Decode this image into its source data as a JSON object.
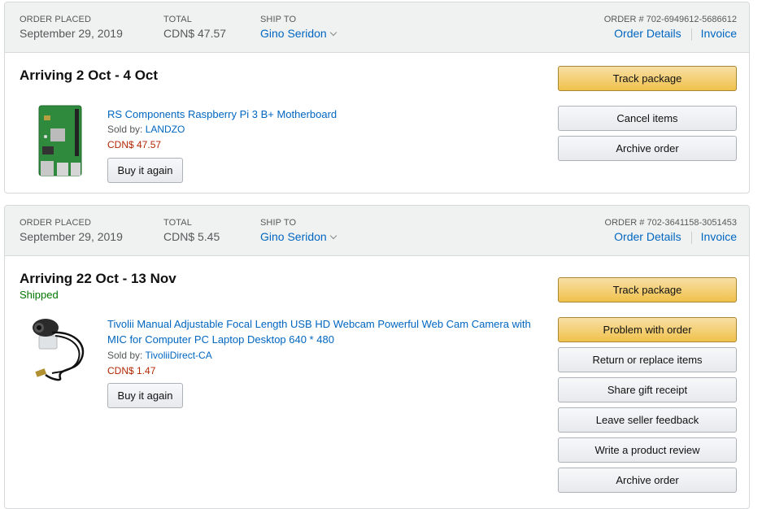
{
  "orders": [
    {
      "order_placed_label": "ORDER PLACED",
      "order_placed": "September 29, 2019",
      "total_label": "TOTAL",
      "total": "CDN$ 47.57",
      "ship_to_label": "SHIP TO",
      "ship_to": "Gino Seridon",
      "order_number": "ORDER # 702-6949612-5686612",
      "order_details_label": "Order Details",
      "invoice_label": "Invoice",
      "arriving": "Arriving 2 Oct - 4 Oct",
      "product_title": "RS Components Raspberry Pi 3 B+ Motherboard",
      "sold_by_label": "Sold by:",
      "seller": "LANDZO",
      "price": "CDN$ 47.57",
      "buy_again_label": "Buy it again",
      "actions": {
        "track": "Track package",
        "cancel": "Cancel items",
        "archive": "Archive order"
      }
    },
    {
      "order_placed_label": "ORDER PLACED",
      "order_placed": "September 29, 2019",
      "total_label": "TOTAL",
      "total": "CDN$ 5.45",
      "ship_to_label": "SHIP TO",
      "ship_to": "Gino Seridon",
      "order_number": "ORDER # 702-3641158-3051453",
      "order_details_label": "Order Details",
      "invoice_label": "Invoice",
      "arriving": "Arriving 22 Oct - 13 Nov",
      "status": "Shipped",
      "product_title_line1": "Tivolii Manual Adjustable Focal Length USB HD Webcam Powerful Web Cam Camera with",
      "product_title_line2": "MIC for Computer PC Laptop Desktop 640 * 480",
      "sold_by_label": "Sold by:",
      "seller": "TivoliiDirect-CA",
      "price": "CDN$ 1.47",
      "buy_again_label": "Buy it again",
      "actions": {
        "track": "Track package",
        "problem": "Problem with order",
        "return": "Return or replace items",
        "gift": "Share gift receipt",
        "feedback": "Leave seller feedback",
        "review": "Write a product review",
        "archive": "Archive order"
      }
    }
  ]
}
